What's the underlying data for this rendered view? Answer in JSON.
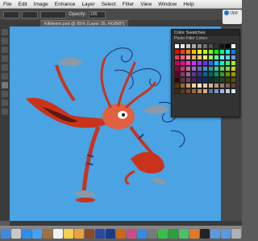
{
  "menubar": {
    "items": [
      "File",
      "Edit",
      "Image",
      "Enhance",
      "Layer",
      "Select",
      "Filter",
      "View",
      "Window",
      "Help"
    ]
  },
  "options_bar": {
    "opacity_label": "Opacity:",
    "opacity_value": "100"
  },
  "document_tab": {
    "title": "Killdeers.psd @ 65% (Layer 35, RGB/8*)"
  },
  "swatches_panel": {
    "title": "Color Swatches",
    "set_name": "Photo Filter Colors",
    "colors": [
      "#ffffff",
      "#e6e6e6",
      "#c8c8c8",
      "#aaaaaa",
      "#8c8c8c",
      "#6e6e6e",
      "#505050",
      "#323232",
      "#141414",
      "#000000",
      "#ffffff",
      "#ff0000",
      "#ff4000",
      "#ff8000",
      "#ffbf00",
      "#ffff00",
      "#bfff00",
      "#80ff00",
      "#00ff00",
      "#00ff80",
      "#00ffff",
      "#0080ff",
      "#ff3366",
      "#ff6680",
      "#ff99aa",
      "#ffaa66",
      "#ffcc66",
      "#eeff66",
      "#99ff66",
      "#66ff99",
      "#66ffee",
      "#66ccff",
      "#6699ff",
      "#cc0066",
      "#ff0099",
      "#ff33cc",
      "#cc33ff",
      "#9933ff",
      "#6633ff",
      "#3366ff",
      "#00ccff",
      "#00ffcc",
      "#33ff66",
      "#99ff00",
      "#990033",
      "#cc3366",
      "#cc6699",
      "#9966cc",
      "#6666cc",
      "#3399cc",
      "#339999",
      "#33cc99",
      "#66cc66",
      "#99cc33",
      "#cccc33",
      "#660033",
      "#993366",
      "#996699",
      "#663399",
      "#333399",
      "#006699",
      "#006666",
      "#009966",
      "#339933",
      "#669900",
      "#999900",
      "#330000",
      "#663333",
      "#664466",
      "#442266",
      "#222266",
      "#003366",
      "#003333",
      "#004433",
      "#224422",
      "#334400",
      "#555500",
      "#663300",
      "#996633",
      "#cc9966",
      "#ffcc99",
      "#ffe6cc",
      "#e6ccb3",
      "#ccb399",
      "#b39980",
      "#997a66",
      "#806050",
      "#604030",
      "#3a2a1a",
      "#5a3a2a",
      "#7a4a2a",
      "#9a6a3a",
      "#ba8a5a",
      "#daaa7a",
      "#5a7a9a",
      "#7a9aba",
      "#9abada",
      "#bad0e6",
      "#dce8f2"
    ]
  },
  "update_badge": {
    "label": "Upd"
  },
  "dock": {
    "icons": [
      "finder-icon",
      "launchpad-icon",
      "safari-icon",
      "mail-icon",
      "contacts-icon",
      "calendar-icon",
      "notes-icon",
      "photos-icon",
      "bridge-icon",
      "elements-icon",
      "photoshop-icon",
      "illustrator-icon",
      "itunes-icon",
      "appstore-icon",
      "preferences-icon",
      "messages-icon",
      "facetime-icon",
      "maps-icon",
      "books-icon",
      "terminal-icon",
      "folder-icon",
      "downloads-icon",
      "trash-icon"
    ],
    "colors": [
      "#3d8be0",
      "#c8c8c8",
      "#2f8fe8",
      "#4aa0f0",
      "#a07040",
      "#f0f0f0",
      "#f2d050",
      "#e8a040",
      "#8a4a2a",
      "#2a4aa0",
      "#1a3a8a",
      "#c86a1a",
      "#d04a8a",
      "#3a8ae0",
      "#7a7a7a",
      "#3ac04a",
      "#2aa03a",
      "#4ac06a",
      "#e07a2a",
      "#222222",
      "#5a9ae0",
      "#5a9ae0",
      "#b0b0b0"
    ]
  }
}
